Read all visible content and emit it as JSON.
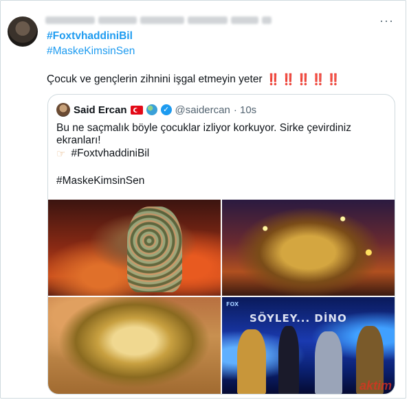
{
  "tweet": {
    "hashtag_1": "#FoxtvhaddiniBil",
    "hashtag_2": "#MaskeKimsinSen",
    "text": "Çocuk ve gençlerin zihnini işgal etmeyin yeter",
    "emphasis": "‼️‼️‼️‼️‼️"
  },
  "quoted": {
    "name": "Said Ercan",
    "handle": "@saidercan",
    "time": "· 10s",
    "line1": "Bu ne saçmalık böyle çocuklar izliyor korkuyor. Sirke çevirdiniz ekranları!",
    "line2_icon": "pointing-hand-icon",
    "line2": "#FoxtvhaddiniBil",
    "line3": "#MaskeKimsinSen",
    "media_banner": "SÖYLEY... DİNO",
    "media_channel": "FOX"
  },
  "watermark": "aktim",
  "icons": {
    "more": "more-icon",
    "verified": "verified-icon",
    "flag": "turkey-flag-icon",
    "globe": "globe-icon"
  },
  "colors": {
    "link": "#1d9bf0",
    "text": "#0f1419",
    "muted": "#536471",
    "emphasis": "#d0021b"
  }
}
